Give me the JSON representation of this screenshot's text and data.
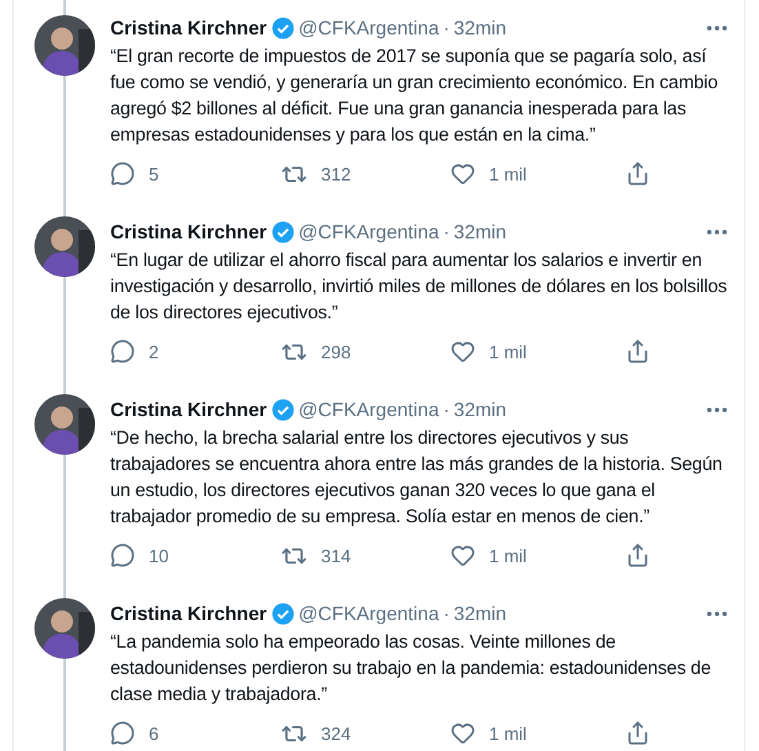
{
  "tweets": [
    {
      "name": "Cristina Kirchner",
      "verified": true,
      "handle": "@CFKArgentina",
      "separator": "·",
      "time": "32min",
      "text": "“El gran recorte de impuestos de 2017 se suponía que se pagaría solo, así fue como se vendió, y generaría un gran crecimiento económico. En cambio agregó $2 billones al déficit. Fue una gran ganancia inesperada para las empresas estadounidenses y para los que están en la cima.”",
      "replies": "5",
      "retweets": "312",
      "likes": "1 mil"
    },
    {
      "name": "Cristina Kirchner",
      "verified": true,
      "handle": "@CFKArgentina",
      "separator": "·",
      "time": "32min",
      "text": "“En lugar de utilizar el ahorro fiscal para aumentar los salarios e invertir en investigación y desarrollo, invirtió miles de millones de dólares en los bolsillos de los directores ejecutivos.”",
      "replies": "2",
      "retweets": "298",
      "likes": "1 mil"
    },
    {
      "name": "Cristina Kirchner",
      "verified": true,
      "handle": "@CFKArgentina",
      "separator": "·",
      "time": "32min",
      "text": "“De hecho, la brecha salarial entre los directores ejecutivos y sus trabajadores se encuentra ahora entre las más grandes de la historia. Según un estudio, los directores ejecutivos ganan 320 veces lo que gana el trabajador promedio de su empresa. Solía estar en menos de cien.”",
      "replies": "10",
      "retweets": "314",
      "likes": "1 mil"
    },
    {
      "name": "Cristina Kirchner",
      "verified": true,
      "handle": "@CFKArgentina",
      "separator": "·",
      "time": "32min",
      "text": "“La pandemia solo ha empeorado las cosas. Veinte millones de estadounidenses perdieron su trabajo en la pandemia: estadounidenses de clase media y trabajadora.”",
      "replies": "6",
      "retweets": "324",
      "likes": "1 mil"
    }
  ]
}
